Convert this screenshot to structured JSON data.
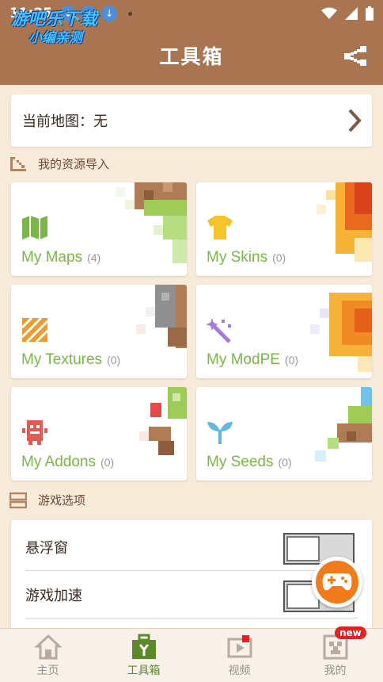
{
  "status_bar": {
    "time": "11:25",
    "watermark_line1": "游吧乐下载",
    "watermark_line2": "小编亲测"
  },
  "header": {
    "title": "工具箱",
    "share_icon": "share-icon"
  },
  "current_map": {
    "label": "当前地图：无"
  },
  "resources_section": {
    "label": "我的资源导入"
  },
  "resources": [
    {
      "name": "My Maps",
      "count": "(4)",
      "color": "#7ab648",
      "icon": "map-icon"
    },
    {
      "name": "My Skins",
      "count": "(0)",
      "color": "#7ab648",
      "icon": "tshirt-icon"
    },
    {
      "name": "My Textures",
      "count": "(0)",
      "color": "#7ab648",
      "icon": "texture-icon"
    },
    {
      "name": "My ModPE",
      "count": "(0)",
      "color": "#7ab648",
      "icon": "magic-wand-icon"
    },
    {
      "name": "My Addons",
      "count": "(0)",
      "color": "#7ab648",
      "icon": "robot-icon"
    },
    {
      "name": "My Seeds",
      "count": "(0)",
      "color": "#7ab648",
      "icon": "sprout-icon"
    }
  ],
  "options_section": {
    "label": "游戏选项"
  },
  "options": [
    {
      "label": "悬浮窗",
      "enabled": false
    },
    {
      "label": "游戏加速",
      "enabled": false
    }
  ],
  "bottom_nav": [
    {
      "label": "主页",
      "icon": "home-icon",
      "active": false
    },
    {
      "label": "工具箱",
      "icon": "toolbox-icon",
      "active": true
    },
    {
      "label": "视频",
      "icon": "video-icon",
      "active": false
    },
    {
      "label": "我的",
      "icon": "creeper-icon",
      "active": false,
      "badge": "new"
    }
  ],
  "colors": {
    "header": "#a87550",
    "background": "#f7ead8",
    "accent_green": "#7ab648",
    "fab_orange": "#f27a1a"
  }
}
